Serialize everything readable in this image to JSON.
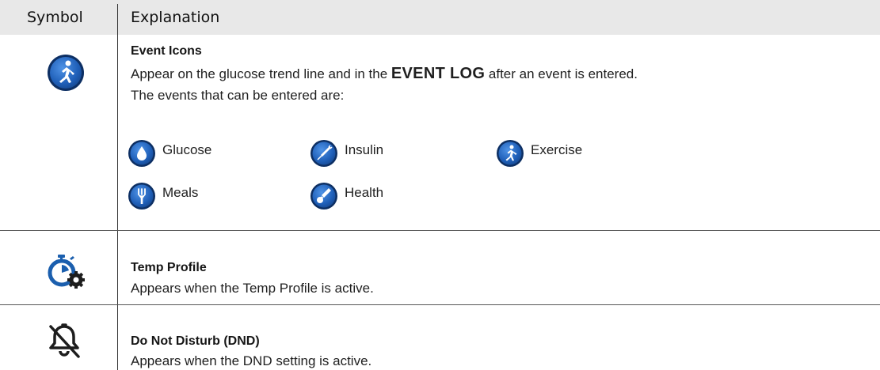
{
  "header": {
    "symbol": "Symbol",
    "explanation": "Explanation"
  },
  "rows": [
    {
      "icon": "exercise-circle-icon",
      "title": "Event Icons",
      "line1_pre": "Appear on the glucose trend line and in the ",
      "line1_em": "EVENT LOG",
      "line1_post": " after an event is entered.",
      "line2": "The events that can be entered are:",
      "events": [
        {
          "label": "Glucose",
          "icon": "glucose-drop-icon"
        },
        {
          "label": "Insulin",
          "icon": "insulin-syringe-icon"
        },
        {
          "label": "Exercise",
          "icon": "exercise-runner-icon"
        },
        {
          "label": "Meals",
          "icon": "meals-fork-icon"
        },
        {
          "label": "Health",
          "icon": "health-thermometer-icon"
        }
      ]
    },
    {
      "icon": "temp-profile-icon",
      "title": "Temp Profile",
      "text": "Appears when the Temp Profile is active."
    },
    {
      "icon": "bell-off-icon",
      "title": "Do Not Disturb (DND)",
      "text": "Appears when the DND setting is active."
    }
  ],
  "colors": {
    "icon_blue": "#1f5fb8",
    "icon_ring": "#0d2f63",
    "header_bg": "#e8e8e8"
  }
}
